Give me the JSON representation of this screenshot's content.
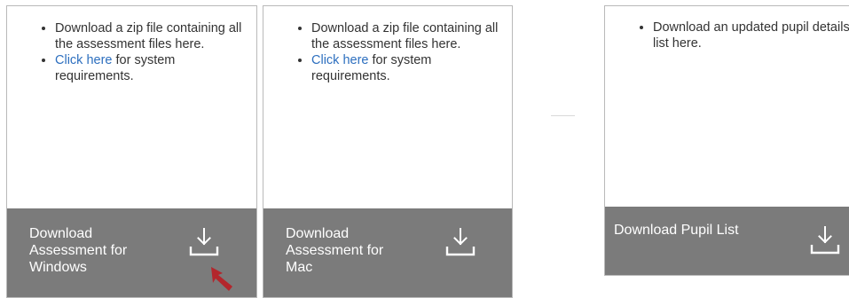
{
  "cards": [
    {
      "bullets": [
        "Download a zip file containing all the assessment files here."
      ],
      "link_text": "Click here",
      "link_suffix": " for system requirements.",
      "footer_label": "Download Assessment for Windows",
      "icon": "download-icon"
    },
    {
      "bullets": [
        "Download a zip file containing all the assessment files here."
      ],
      "link_text": "Click here",
      "link_suffix": " for system requirements.",
      "footer_label": "Download Assessment for Mac",
      "icon": "download-icon"
    },
    {
      "bullets": [
        "Download an updated pupil details list here."
      ],
      "footer_label": "Download Pupil List",
      "icon": "download-icon"
    }
  ],
  "colors": {
    "footer_bg": "#7b7b7b",
    "link": "#2d6fbf",
    "card_border": "#b9b9b9",
    "cursor": "#b3262c"
  }
}
